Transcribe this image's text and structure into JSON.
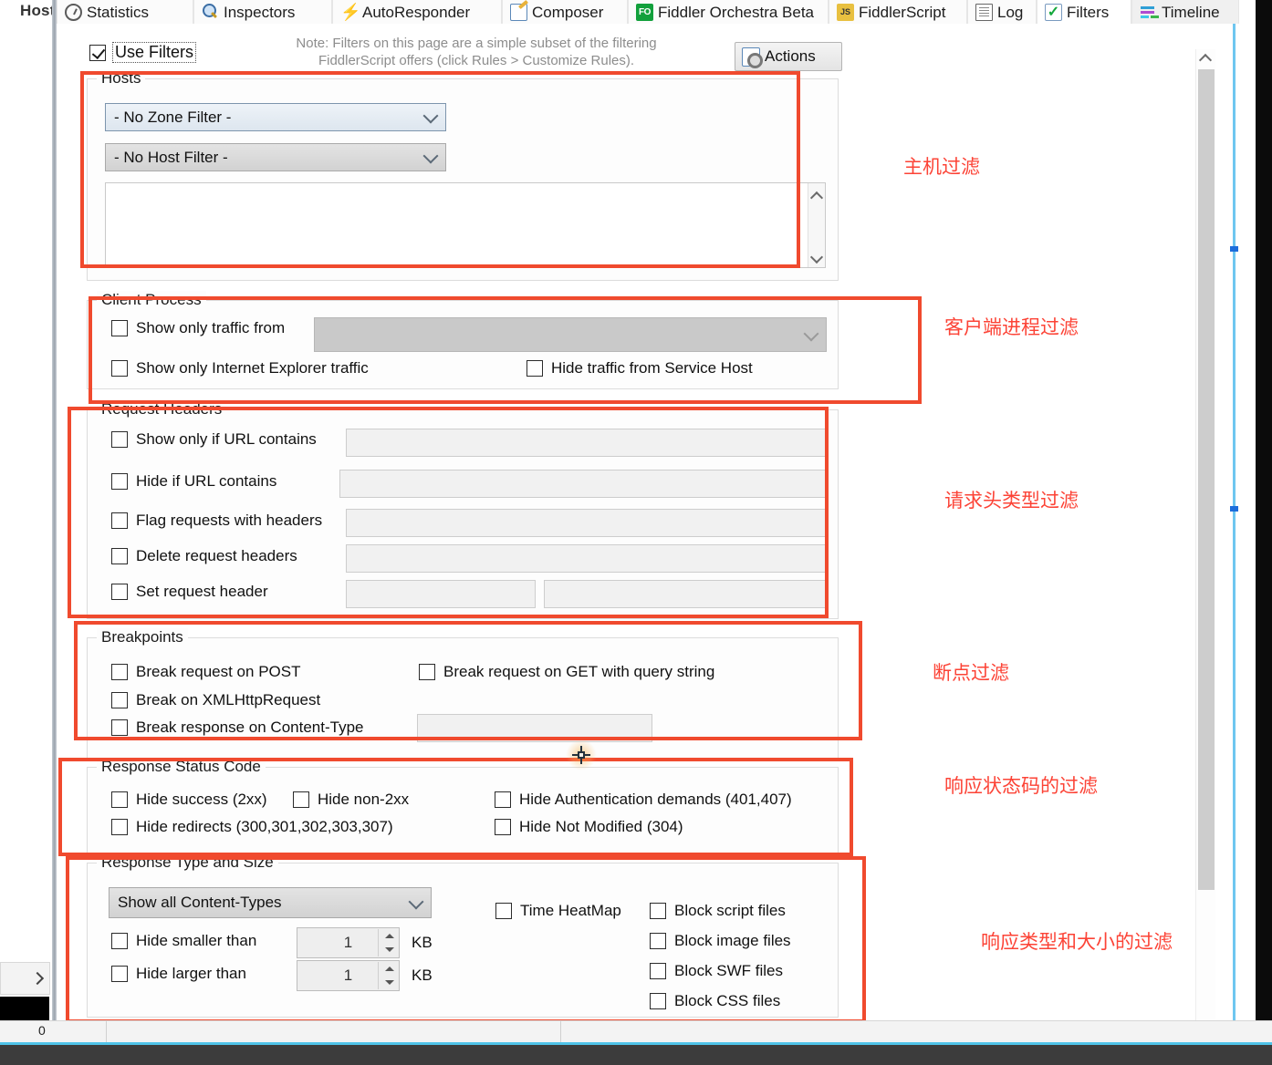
{
  "tabs": {
    "left_label": "Host",
    "items": [
      {
        "label": "Statistics",
        "icon": "clock-icon",
        "active": false
      },
      {
        "label": "Inspectors",
        "icon": "magnifier-icon",
        "active": false
      },
      {
        "label": "AutoResponder",
        "icon": "bolt-icon",
        "active": false
      },
      {
        "label": "Composer",
        "icon": "notepad-pencil-icon",
        "active": false
      },
      {
        "label": "Fiddler Orchestra Beta",
        "icon": "fo-badge-icon",
        "active": false
      },
      {
        "label": "FiddlerScript",
        "icon": "js-script-icon",
        "active": false
      },
      {
        "label": "Log",
        "icon": "log-lines-icon",
        "active": false
      },
      {
        "label": "Filters",
        "icon": "green-check-icon",
        "active": true
      },
      {
        "label": "Timeline",
        "icon": "timeline-bars-icon",
        "active": false
      }
    ]
  },
  "header": {
    "use_filters_label": "Use Filters",
    "use_filters_checked": true,
    "note_line1": "Note: Filters on this page are a simple subset of the filtering",
    "note_line2": "FiddlerScript offers (click Rules > Customize Rules).",
    "actions_label": "Actions"
  },
  "hosts": {
    "title": "Hosts",
    "zone_filter": "- No Zone Filter -",
    "host_filter": "- No Host Filter -",
    "host_list_value": ""
  },
  "client_process": {
    "title": "Client Process",
    "show_only_traffic_from": {
      "label": "Show only traffic from",
      "checked": false,
      "value": ""
    },
    "show_only_ie_traffic": {
      "label": "Show only Internet Explorer traffic",
      "checked": false
    },
    "hide_service_host": {
      "label": "Hide traffic from Service Host",
      "checked": false
    }
  },
  "request_headers": {
    "title": "Request Headers",
    "rows": [
      {
        "label": "Show only if URL contains",
        "checked": false,
        "value": ""
      },
      {
        "label": "Hide if URL contains",
        "checked": false,
        "value": ""
      },
      {
        "label": "Flag requests with headers",
        "checked": false,
        "value": ""
      },
      {
        "label": "Delete request headers",
        "checked": false,
        "value": ""
      },
      {
        "label": "Set request header",
        "checked": false,
        "value": "",
        "value2": ""
      }
    ]
  },
  "breakpoints": {
    "title": "Breakpoints",
    "break_post": {
      "label": "Break request on POST",
      "checked": false
    },
    "break_get_query": {
      "label": "Break request on GET with query string",
      "checked": false
    },
    "break_xhr": {
      "label": "Break on XMLHttpRequest",
      "checked": false
    },
    "break_response_ct": {
      "label": "Break response on Content-Type",
      "checked": false,
      "value": ""
    }
  },
  "response_status": {
    "title": "Response Status Code",
    "hide_success": {
      "label": "Hide success (2xx)",
      "checked": false
    },
    "hide_non_2xx": {
      "label": "Hide non-2xx",
      "checked": false
    },
    "hide_auth": {
      "label": "Hide Authentication demands (401,407)",
      "checked": false
    },
    "hide_redirects": {
      "label": "Hide redirects (300,301,302,303,307)",
      "checked": false
    },
    "hide_not_modified": {
      "label": "Hide Not Modified (304)",
      "checked": false
    }
  },
  "response_type_size": {
    "title": "Response Type and Size",
    "content_types": "Show all Content-Types",
    "hide_smaller": {
      "label": "Hide smaller than",
      "checked": false,
      "value": "1",
      "unit": "KB"
    },
    "hide_larger": {
      "label": "Hide larger than",
      "checked": false,
      "value": "1",
      "unit": "KB"
    },
    "time_heatmap": {
      "label": "Time HeatMap",
      "checked": false
    },
    "block_script": {
      "label": "Block script files",
      "checked": false
    },
    "block_image": {
      "label": "Block image files",
      "checked": false
    },
    "block_swf": {
      "label": "Block SWF files",
      "checked": false
    },
    "block_css": {
      "label": "Block CSS files",
      "checked": false
    }
  },
  "annotations": {
    "color": "#fc4336",
    "labels": [
      "主机过滤",
      "客户端进程过滤",
      "请求头类型过滤",
      "断点过滤",
      "响应状态码的过滤",
      "响应类型和大小的过滤"
    ]
  },
  "statusbar": {
    "count": "0"
  }
}
